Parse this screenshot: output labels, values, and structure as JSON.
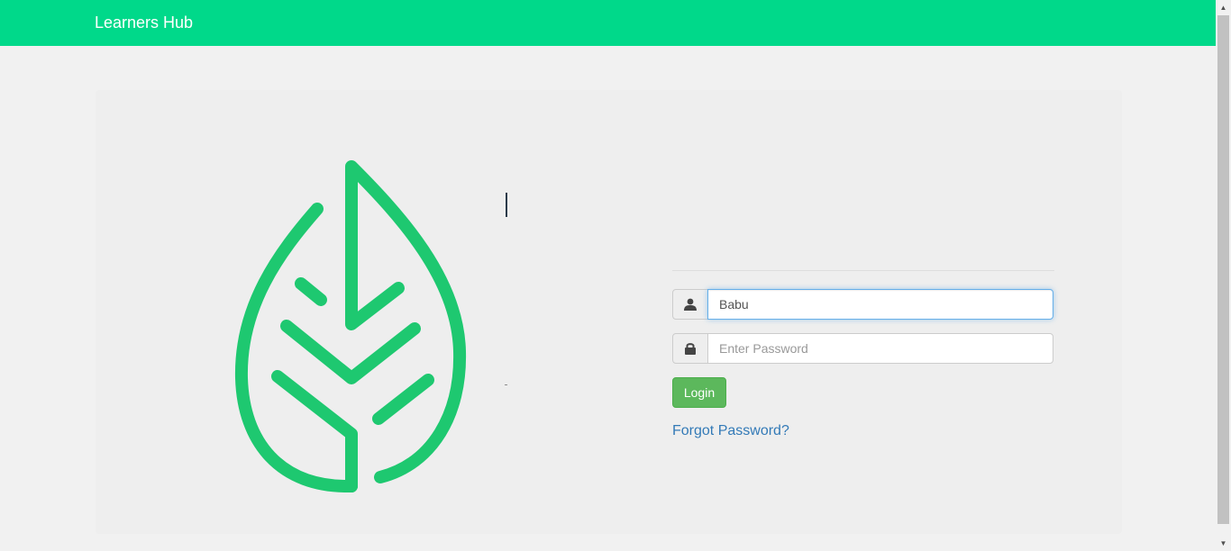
{
  "navbar": {
    "brand": "Learners Hub"
  },
  "colors": {
    "accent": "#00d98a",
    "logo": "#1ec870",
    "button": "#5cb85c",
    "link": "#337ab7"
  },
  "login_form": {
    "username": {
      "icon": "user-icon",
      "value": "Babu",
      "placeholder": ""
    },
    "password": {
      "icon": "lock-icon",
      "value": "",
      "placeholder": "Enter Password"
    },
    "login_label": "Login",
    "forgot_label": "Forgot Password?"
  },
  "logo": {
    "icon": "leaf-logo-icon"
  }
}
